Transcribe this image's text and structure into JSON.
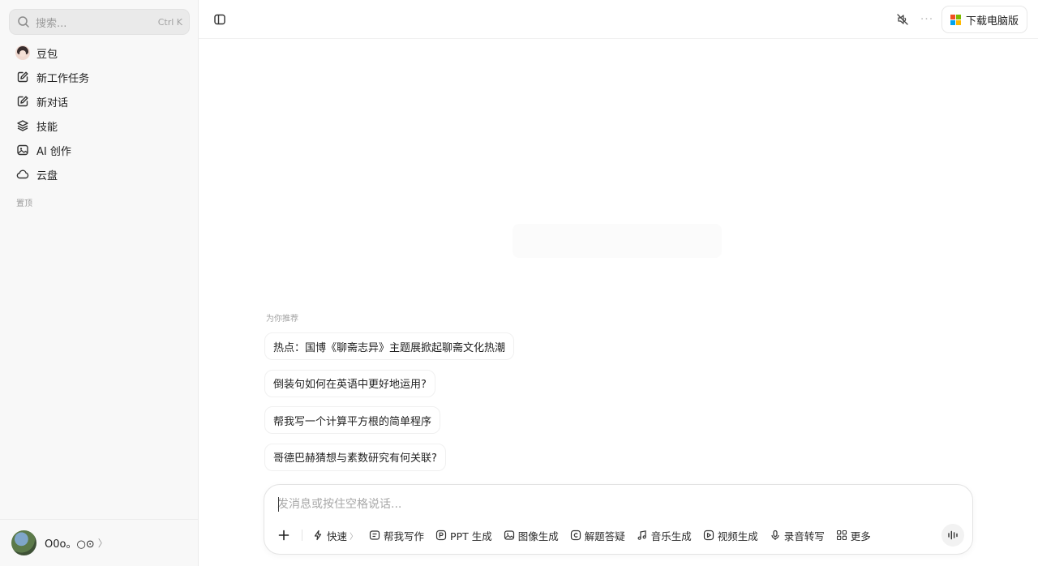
{
  "sidebar": {
    "search": {
      "placeholder": "搜索...",
      "shortcut": "Ctrl K"
    },
    "items": [
      {
        "label": "豆包",
        "icon": "doubao-avatar"
      },
      {
        "label": "新工作任务",
        "icon": "edit-icon"
      },
      {
        "label": "新对话",
        "icon": "edit-icon"
      },
      {
        "label": "技能",
        "icon": "layers-icon"
      },
      {
        "label": "AI 创作",
        "icon": "image-icon"
      },
      {
        "label": "云盘",
        "icon": "cloud-icon"
      }
    ],
    "section_label": "置顶",
    "user": {
      "name": "O0o。○⊙",
      "chevron": "〉"
    }
  },
  "topbar": {
    "download_label": "下载电脑版",
    "more_label": "···",
    "ms_colors": [
      "#f25022",
      "#7fba00",
      "#00a4ef",
      "#ffb900"
    ]
  },
  "main": {
    "recommend_label": "为你推荐",
    "recommendations": [
      "热点：国博《聊斋志异》主题展掀起聊斋文化热潮",
      "倒装句如何在英语中更好地运用?",
      "帮我写一个计算平方根的简单程序",
      "哥德巴赫猜想与素数研究有何关联?"
    ]
  },
  "composer": {
    "placeholder": "发消息或按住空格说话...",
    "tools": [
      {
        "label": "快速",
        "icon": "bolt-icon",
        "chevron": "〉"
      },
      {
        "label": "帮我写作",
        "icon": "doc-icon"
      },
      {
        "label": "PPT 生成",
        "icon": "ppt-icon"
      },
      {
        "label": "图像生成",
        "icon": "image-icon"
      },
      {
        "label": "解题答疑",
        "icon": "solve-icon"
      },
      {
        "label": "音乐生成",
        "icon": "music-icon"
      },
      {
        "label": "视频生成",
        "icon": "video-icon"
      },
      {
        "label": "录音转写",
        "icon": "mic-icon"
      },
      {
        "label": "更多",
        "icon": "grid-icon"
      }
    ]
  }
}
